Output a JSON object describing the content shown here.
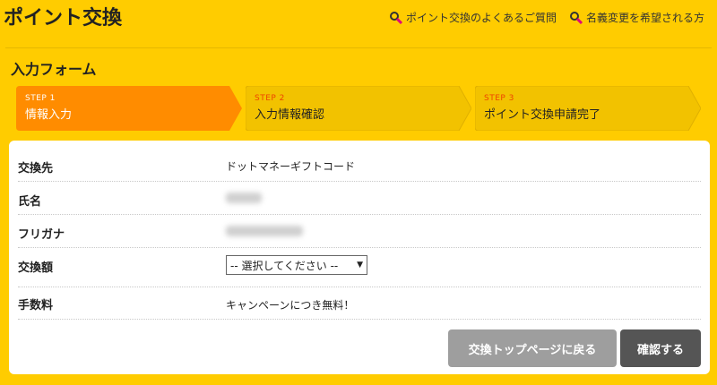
{
  "header": {
    "title": "ポイント交換",
    "links": [
      {
        "label": "ポイント交換のよくあるご質問",
        "icon": "help-search-icon"
      },
      {
        "label": "名義変更を希望される方",
        "icon": "help-search-icon"
      }
    ]
  },
  "form": {
    "title": "入力フォーム",
    "steps": [
      {
        "num": "STEP 1",
        "label": "情報入力",
        "state": "active"
      },
      {
        "num": "STEP 2",
        "label": "入力情報確認",
        "state": "inactive"
      },
      {
        "num": "STEP 3",
        "label": "ポイント交換申請完了",
        "state": "inactive"
      }
    ],
    "rows": [
      {
        "key": "交換先",
        "value": "ドットマネーギフトコード"
      },
      {
        "key": "氏名",
        "value": ""
      },
      {
        "key": "フリガナ",
        "value": ""
      },
      {
        "key": "交換額",
        "select": "-- 選択してください --"
      },
      {
        "key": "手数料",
        "value": "キャンペーンにつき無料！"
      }
    ],
    "buttons": {
      "back": "交換トップページに戻る",
      "confirm": "確認する"
    }
  },
  "colors": {
    "background": "#ffcc00",
    "step_active": "#ff8c00",
    "step_inactive": "#f2c200",
    "step_num_inactive": "#ee4400",
    "button_back": "#9e9e9e",
    "button_confirm": "#555555"
  }
}
